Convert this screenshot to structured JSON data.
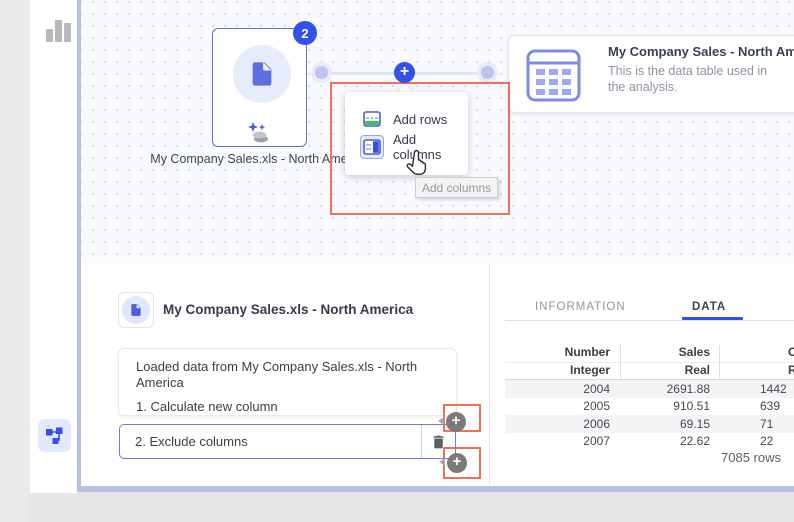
{
  "colors": {
    "accent_blue": "#3350e8",
    "highlight_orange": "#ee7155",
    "add_rows_green": "#3fbf52",
    "tab_underline": "#3350e8"
  },
  "canvas": {
    "source_node": {
      "badge": "2",
      "label": "My Company Sales.xls - North America"
    },
    "table_node": {
      "title": "My Company Sales - North America",
      "description": "This is the data table used in the analysis."
    },
    "popup": {
      "items": [
        {
          "label": "Add rows"
        },
        {
          "label": "Add columns"
        }
      ],
      "tooltip": "Add columns"
    }
  },
  "details": {
    "source_title": "My Company Sales.xls - North America",
    "log_entry": "Loaded data from My Company Sales.xls - North America",
    "log_step": "1. Calculate new column",
    "selected_step": "2. Exclude columns"
  },
  "data_panel": {
    "tabs": [
      {
        "label": "INFORMATION",
        "active": false
      },
      {
        "label": "DATA",
        "active": true
      }
    ],
    "row_count_label": "7085 rows",
    "table": {
      "columns": [
        {
          "name": "Number",
          "type": "Integer"
        },
        {
          "name": "Sales",
          "type": "Real"
        },
        {
          "name": "C",
          "type": "R"
        }
      ],
      "rows": [
        [
          "2004",
          "2691.88",
          "1442"
        ],
        [
          "2005",
          "910.51",
          "639"
        ],
        [
          "2006",
          "69.15",
          "71"
        ],
        [
          "2007",
          "22.62",
          "22"
        ]
      ]
    }
  }
}
